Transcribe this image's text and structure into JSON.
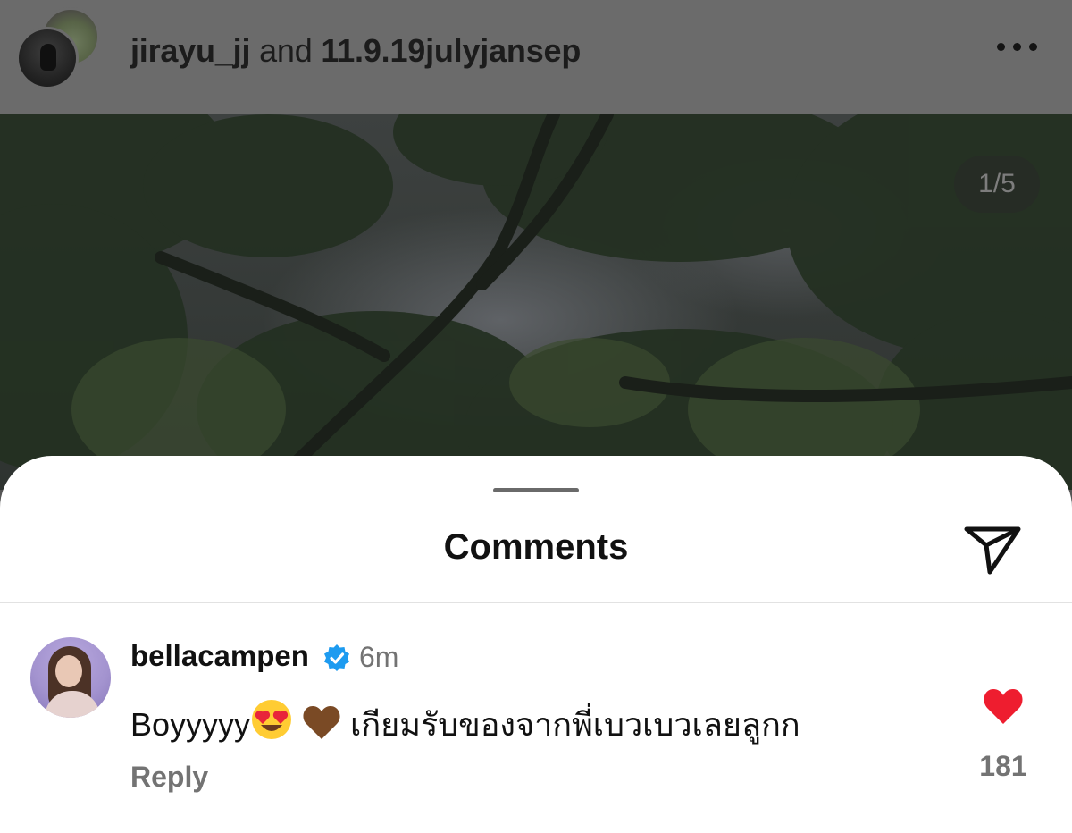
{
  "header": {
    "username": "jirayu_jj",
    "connector": " and ",
    "collaborator": "11.9.19julyjansep",
    "more_icon": "more-horizontal-icon"
  },
  "post": {
    "page_counter": "1/5"
  },
  "comments_sheet": {
    "title": "Comments",
    "share_icon": "paper-plane-icon",
    "comment": {
      "author": "bellacampen",
      "verified": true,
      "time": "6m",
      "text_prefix": "Boyyyyy",
      "emojis": [
        "😍",
        "🤎"
      ],
      "text_suffix": " เกียมรับของจากพี่เบวเบวเลยลูกก",
      "reply_label": "Reply",
      "likes": "181",
      "liked": true
    }
  },
  "colors": {
    "heart": "#ee1d2f",
    "verified": "#1d9bf0",
    "muted_text": "#737373"
  }
}
